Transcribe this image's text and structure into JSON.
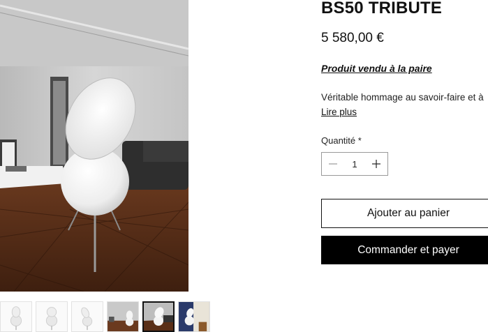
{
  "product": {
    "title": "BS50 TRIBUTE",
    "price": "5 580,00 €",
    "sold_note": "Produit vendu à la paire",
    "description": "Véritable hommage au savoir-faire et à",
    "read_more": "Lire plus"
  },
  "quantity": {
    "label": "Quantité *",
    "value": "1",
    "minus_icon": "minus-icon",
    "plus_icon": "plus-icon"
  },
  "actions": {
    "add_to_cart": "Ajouter au panier",
    "buy_now": "Commander et payer"
  },
  "gallery": {
    "selected_index": 4,
    "thumbnail_count": 6
  },
  "colors": {
    "text": "#111111",
    "buy_button_bg": "#000000",
    "buy_button_text": "#ffffff",
    "border": "#999999"
  }
}
